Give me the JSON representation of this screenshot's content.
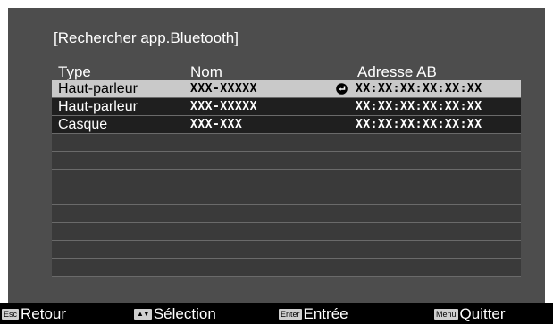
{
  "dialog": {
    "title": "[Rechercher app.Bluetooth]"
  },
  "table": {
    "headers": {
      "type": "Type",
      "name": "Nom",
      "address": "Adresse AB"
    },
    "rows": [
      {
        "type": "Haut-parleur",
        "name": "XXX-XXXXX",
        "address": "XX:XX:XX:XX:XX:XX",
        "selected": true
      },
      {
        "type": "Haut-parleur",
        "name": "XXX-XXXXX",
        "address": "XX:XX:XX:XX:XX:XX",
        "selected": false
      },
      {
        "type": "Casque",
        "name": "XXX-XXX",
        "address": "XX:XX:XX:XX:XX:XX",
        "selected": false
      }
    ],
    "empty_rows": 8
  },
  "footer": {
    "back": {
      "key": "Esc",
      "label": "Retour"
    },
    "select": {
      "key": "▲▼",
      "label": "Sélection"
    },
    "enter": {
      "key": "Enter",
      "label": "Entrée"
    },
    "quit": {
      "key": "Menu",
      "label": "Quitter"
    }
  },
  "colors": {
    "screen_bg": "#4d4d4d",
    "selected_row": "#c9c9c9",
    "item_row": "#1f1f1f",
    "footer_bg": "#000000"
  },
  "icons": {
    "selection_cursor": "return-arrow-icon"
  }
}
